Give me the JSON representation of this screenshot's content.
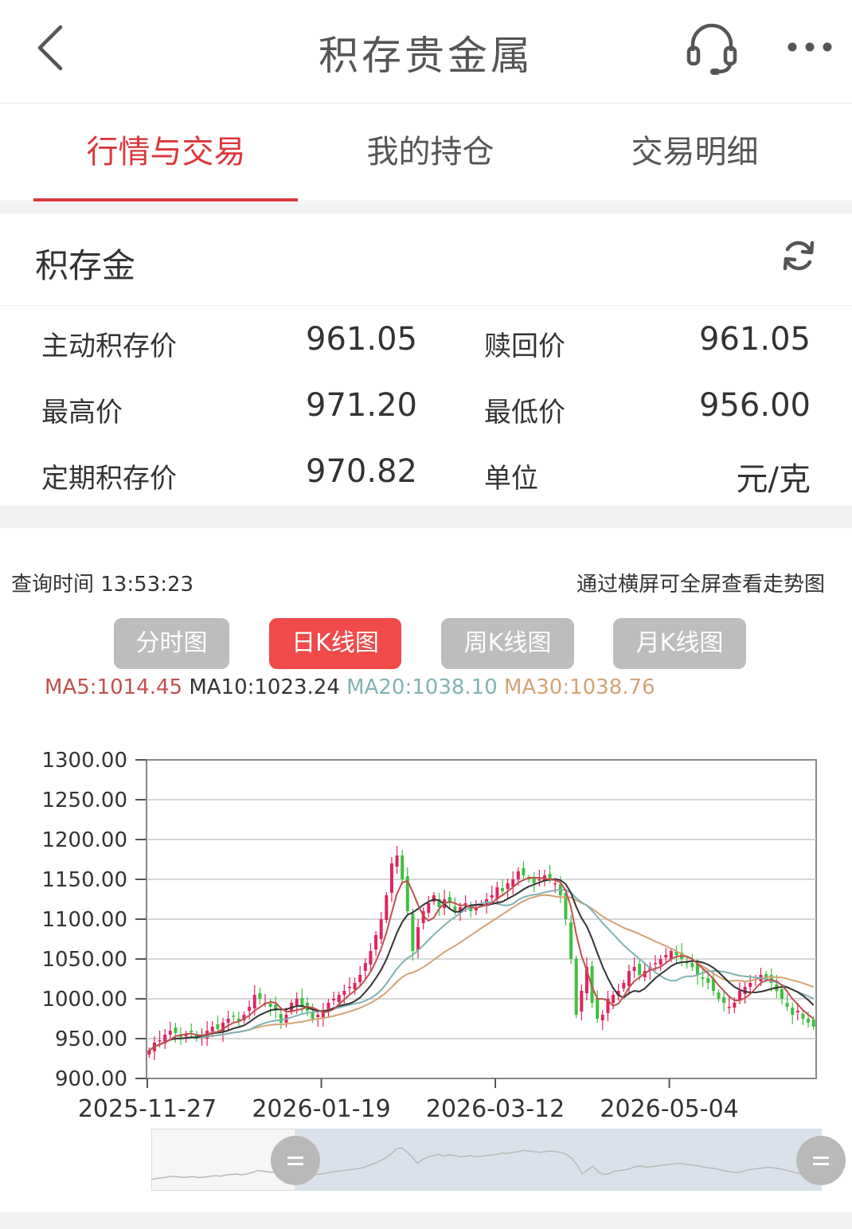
{
  "header": {
    "title": "积存贵金属",
    "back_icon": "chevron-left-icon",
    "service_icon": "headset-icon",
    "more_icon": "more-icon"
  },
  "tabs": [
    {
      "label": "行情与交易",
      "active": true
    },
    {
      "label": "我的持仓",
      "active": false
    },
    {
      "label": "交易明细",
      "active": false
    }
  ],
  "section": {
    "title": "积存金",
    "refresh_icon": "refresh-icon"
  },
  "prices": {
    "active_save_label": "主动积存价",
    "active_save_value": "961.05",
    "redeem_label": "赎回价",
    "redeem_value": "961.05",
    "high_label": "最高价",
    "high_value": "971.20",
    "low_label": "最低价",
    "low_value": "956.00",
    "fixed_label": "定期积存价",
    "fixed_value": "970.82",
    "unit_label": "单位",
    "unit_value": "元/克"
  },
  "query": {
    "time": "查询时间 13:53:23",
    "hint": "通过横屏可全屏查看走势图"
  },
  "kline_buttons": [
    {
      "label": "分时图",
      "active": false
    },
    {
      "label": "日K线图",
      "active": true
    },
    {
      "label": "周K线图",
      "active": false
    },
    {
      "label": "月K线图",
      "active": false
    }
  ],
  "ma": {
    "ma5": "MA5:1014.45",
    "ma10": "MA10:1023.24",
    "ma20": "MA20:1038.10",
    "ma30": "MA30:1038.76"
  },
  "colors": {
    "accent": "#d9383a",
    "up": "#e0245e",
    "down": "#3fbf3f",
    "ma5": "#c0504d",
    "ma10": "#333333",
    "ma20": "#7fb3b3",
    "ma30": "#d4a373"
  },
  "chart_data": {
    "type": "candlestick",
    "ylim": [
      900,
      1300
    ],
    "y_ticks": [
      "1300.00",
      "1250.00",
      "1200.00",
      "1150.00",
      "1100.00",
      "1050.00",
      "1000.00",
      "950.00",
      "900.00"
    ],
    "x_ticks": [
      "2025-11-27",
      "2026-01-19",
      "2026-03-12",
      "2026-05-04"
    ],
    "close": [
      935,
      945,
      948,
      955,
      960,
      957,
      952,
      955,
      958,
      950,
      955,
      960,
      965,
      962,
      970,
      975,
      978,
      972,
      980,
      990,
      1005,
      1000,
      995,
      990,
      985,
      970,
      980,
      995,
      1000,
      990,
      985,
      975,
      980,
      985,
      995,
      1000,
      1005,
      1010,
      1015,
      1020,
      1030,
      1045,
      1060,
      1080,
      1100,
      1130,
      1170,
      1180,
      1150,
      1110,
      1060,
      1090,
      1110,
      1120,
      1130,
      1115,
      1125,
      1120,
      1110,
      1115,
      1120,
      1110,
      1115,
      1120,
      1125,
      1130,
      1140,
      1135,
      1145,
      1150,
      1160,
      1155,
      1150,
      1145,
      1150,
      1155,
      1150,
      1145,
      1130,
      1100,
      1050,
      980,
      1010,
      1040,
      995,
      975,
      980,
      1000,
      1005,
      1010,
      1020,
      1035,
      1040,
      1030,
      1035,
      1040,
      1045,
      1050,
      1055,
      1060,
      1055,
      1050,
      1045,
      1040,
      1030,
      1025,
      1020,
      1010,
      1000,
      995,
      990,
      995,
      1010,
      1015,
      1020,
      1025,
      1030,
      1025,
      1020,
      1010,
      1000,
      990,
      980,
      985,
      975,
      970,
      965
    ]
  }
}
